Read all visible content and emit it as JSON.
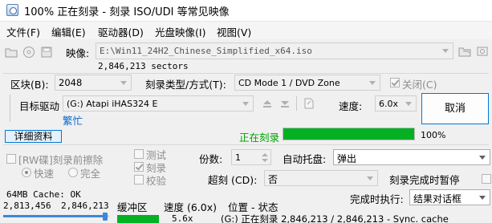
{
  "window": {
    "title": "100% 正在刻录 - 刻录 ISO/UDI 等常见映像"
  },
  "menu": [
    "文件(F)",
    "编辑(E)",
    "驱动器(D)",
    "光盘映像(I)",
    "视图(V)"
  ],
  "image": {
    "label": "映像:",
    "path": "E:\\Win11_24H2_Chinese_Simplified_x64.iso",
    "sectors": "2,846,213 sectors"
  },
  "block": {
    "label": "区块(B):",
    "value": "2048"
  },
  "burn_type": {
    "label": "刻录类型/方式(T):",
    "value": "CD Mode 1 / DVD Zone"
  },
  "close_checkbox": {
    "label": "关闭(C)",
    "checked": true
  },
  "drive": {
    "label": "目标驱动",
    "value": "(G:) Atapi iHAS324 E",
    "status": "繁忙"
  },
  "speed": {
    "label": "速度:",
    "value": "6.0x"
  },
  "cancel_button": "取消",
  "details_button": "详细资料",
  "progress": {
    "label": "正在刻录",
    "percent_text": "100%",
    "value": 100
  },
  "options": {
    "rw_erase": "[RW碟]刻录前擦除",
    "quick": "快速",
    "full": "完全",
    "test": "测试",
    "burn": "刻录",
    "verify": "校验"
  },
  "copies": {
    "label": "份数:",
    "value": "1"
  },
  "auto_eject": {
    "label": "自动托盘:",
    "value": "弹出"
  },
  "overburn": {
    "label": "超刻 (CD):",
    "value": "否"
  },
  "pause_after": "刻录完成时暂停",
  "on_complete": {
    "label": "完成时执行:",
    "value": "结果对话框"
  },
  "status": {
    "cache_label": "64MB Cache: OK",
    "sectors_written": "2,813,456",
    "sectors_total": "2,846,213",
    "buffer_label": "缓冲区",
    "speed_label": "速度 (6.0x)",
    "position_label": "位置 - 状态",
    "speed_value": "5.6x",
    "position_status": "(G:) 正在刻录 2,846,213 / 2,846,213 - Sync. cache"
  }
}
